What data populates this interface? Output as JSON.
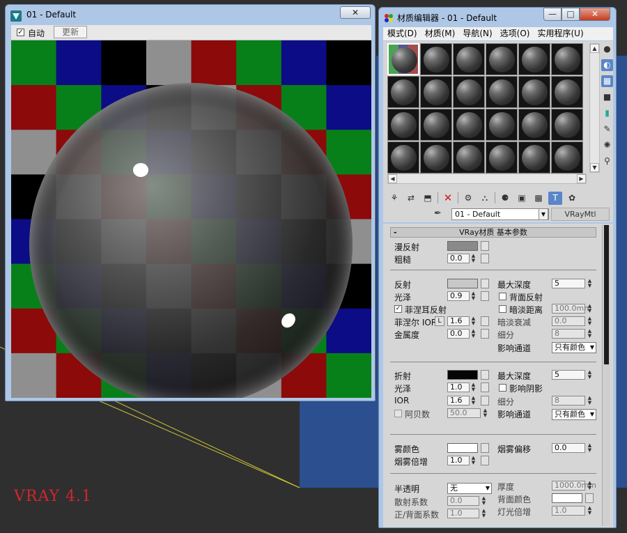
{
  "viewport": {
    "label": "VRAY 4.1"
  },
  "render_window": {
    "title": "01 - Default",
    "close_label": "✕",
    "auto_label": "自动",
    "auto_checked": true,
    "update_label": "更新"
  },
  "material_editor": {
    "title": "材质编辑器 - 01 - Default",
    "window_buttons": {
      "minimize": "—",
      "maximize": "□",
      "close": "✕"
    },
    "menu": [
      "模式(D)",
      "材质(M)",
      "导航(N)",
      "选项(O)",
      "实用程序(U)"
    ],
    "slot_count": 24,
    "side_icons": [
      "sphere-icon",
      "backlight-icon",
      "checker-background-icon",
      "sample-uv-icon",
      "video-color-check-icon",
      "make-preview-icon",
      "options-icon",
      "select-by-material-icon"
    ],
    "toolbar_icons": [
      "get-material-icon",
      "put-to-scene-icon",
      "assign-to-selection-icon",
      "delete-icon",
      "make-unique-icon",
      "put-to-library-icon",
      "material-id-icon",
      "show-in-viewport-icon",
      "show-end-result-icon",
      "go-to-parent-icon",
      "go-forward-sibling-icon"
    ],
    "material_name": "01 - Default",
    "material_type": "VRayMtl"
  },
  "params": {
    "rollout_title": "VRay材质 基本参数",
    "diffuse": {
      "label": "漫反射",
      "color": "#8a8a8a"
    },
    "roughness": {
      "label": "粗糙",
      "value": "0.0"
    },
    "reflect": {
      "label": "反射",
      "color": "#c8c8c8"
    },
    "gloss": {
      "label": "光泽",
      "value": "0.9"
    },
    "fresnel": {
      "label": "菲涅耳反射",
      "checked": true
    },
    "fresnel_ior": {
      "label": "菲涅尔 IOR",
      "lock": "L",
      "value": "1.6"
    },
    "metalness": {
      "label": "金属度",
      "value": "0.0"
    },
    "max_depth": {
      "label": "最大深度",
      "value": "5"
    },
    "back_reflect": {
      "label": "背面反射",
      "checked": false
    },
    "dim_distance": {
      "label": "暗淡距离",
      "checked": false,
      "value": "100.0mm"
    },
    "dim_falloff": {
      "label": "暗淡衰减",
      "value": "0.0"
    },
    "subdivs": {
      "label": "细分",
      "value": "8"
    },
    "affect_channels": {
      "label": "影响通道",
      "value": "只有颜色"
    },
    "refract": {
      "label": "折射",
      "color": "#050505"
    },
    "refr_gloss": {
      "label": "光泽",
      "value": "1.0"
    },
    "ior": {
      "label": "IOR",
      "value": "1.6"
    },
    "abbe": {
      "label": "阿贝数",
      "checked": false,
      "value": "50.0"
    },
    "refr_max_depth": {
      "label": "最大深度",
      "value": "5"
    },
    "affect_shadows": {
      "label": "影响阴影",
      "checked": false
    },
    "refr_subdivs": {
      "label": "细分",
      "value": "8"
    },
    "refr_affect_channels": {
      "label": "影响通道",
      "value": "只有颜色"
    },
    "fog_color": {
      "label": "雾颜色",
      "color": "#ffffff"
    },
    "fog_multiplier": {
      "label": "烟雾倍增",
      "value": "1.0"
    },
    "fog_bias": {
      "label": "烟雾偏移",
      "value": "0.0"
    },
    "translucency": {
      "label": "半透明",
      "value": "无"
    },
    "scatter_coeff": {
      "label": "散射系数",
      "value": "0.0"
    },
    "fwd_back_coeff": {
      "label": "正/背面系数",
      "value": "1.0"
    },
    "thickness": {
      "label": "厚度",
      "value": "1000.0mm"
    },
    "back_color": {
      "label": "背面颜色",
      "color": "#ffffff"
    },
    "light_multiplier": {
      "label": "灯光倍增",
      "value": "1.0"
    }
  }
}
